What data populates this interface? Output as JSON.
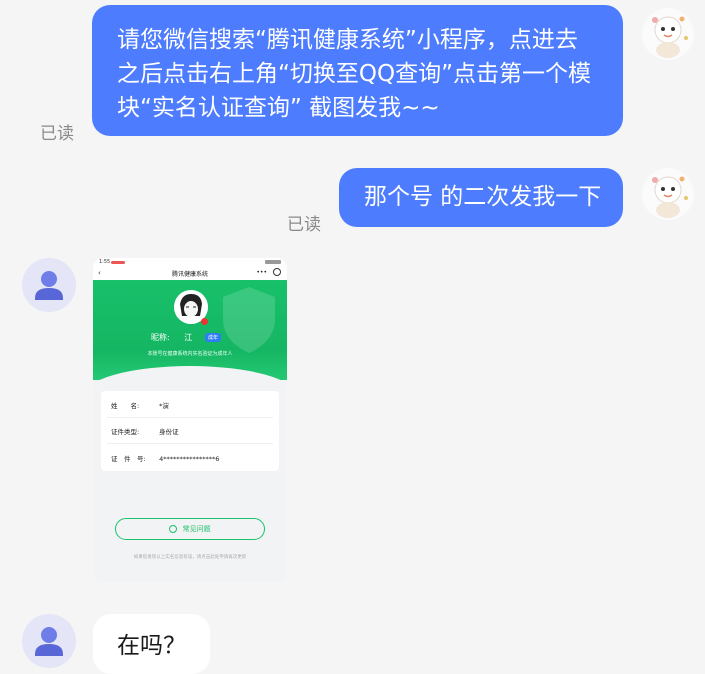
{
  "messages": {
    "m1": {
      "lines": [
        "请您微信搜索“腾讯健康系统”小程序，点进去",
        "之后点击右上角“切换至QQ查询”点击第一个模",
        "块“实名认证查询” 截图发我~~"
      ],
      "status": "已读"
    },
    "m2": {
      "text": "那个号 的二次发我一下",
      "status": "已读"
    },
    "m4": {
      "text": "在吗？"
    }
  },
  "shot": {
    "status_time": "1:55",
    "title": "腾讯健康系统",
    "nick_label": "昵称:",
    "nick_value": "江",
    "adult_badge": "成年",
    "notice": "本账号在健康系统内实名验证为成年人",
    "fields": [
      {
        "label": "姓　　名:",
        "value": "*演"
      },
      {
        "label": "证件类型:",
        "value": "身份证"
      },
      {
        "label": "证　件　号:",
        "value": "4****************6"
      }
    ],
    "faq": "常见问题",
    "foot": "如果您发现以上实名信息有误，请点击此处申请再次更新"
  },
  "colors": {
    "bubble_out": "#4d7cfe",
    "bubble_in": "#ffffff",
    "accent_green": "#1cc26b"
  },
  "icons": [
    "self-avatar-icon",
    "user-avatar-icon",
    "back-arrow-icon",
    "more-menu-icon",
    "close-target-icon",
    "shield-icon",
    "help-circle-icon"
  ]
}
